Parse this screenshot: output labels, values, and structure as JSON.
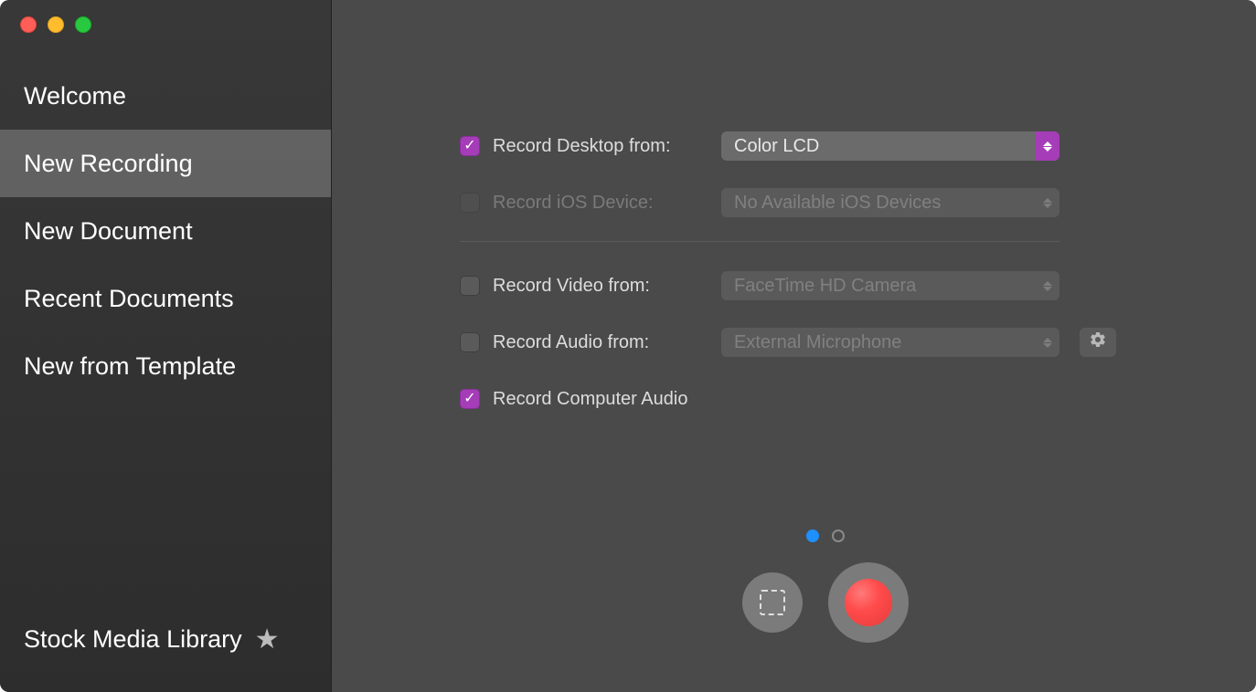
{
  "sidebar": {
    "items": [
      {
        "label": "Welcome",
        "selected": false
      },
      {
        "label": "New Recording",
        "selected": true
      },
      {
        "label": "New Document",
        "selected": false
      },
      {
        "label": "Recent Documents",
        "selected": false
      },
      {
        "label": "New from Template",
        "selected": false
      }
    ],
    "footer": {
      "label": "Stock Media Library"
    }
  },
  "options": {
    "record_desktop": {
      "label": "Record Desktop from:",
      "checked": true,
      "value": "Color LCD",
      "enabled": true
    },
    "record_ios": {
      "label": "Record iOS Device:",
      "checked": false,
      "value": "No Available iOS Devices",
      "enabled": false
    },
    "record_video": {
      "label": "Record Video from:",
      "checked": false,
      "value": "FaceTime HD Camera",
      "enabled": true
    },
    "record_audio": {
      "label": "Record Audio from:",
      "checked": false,
      "value": "External Microphone",
      "enabled": true
    },
    "record_computer_audio": {
      "label": "Record Computer Audio",
      "checked": true
    }
  },
  "pager": {
    "current": 1,
    "total": 2
  },
  "colors": {
    "accent_purple": "#a63db8",
    "record_red": "#ff4b4b",
    "page_dot_active": "#1e90ff"
  }
}
